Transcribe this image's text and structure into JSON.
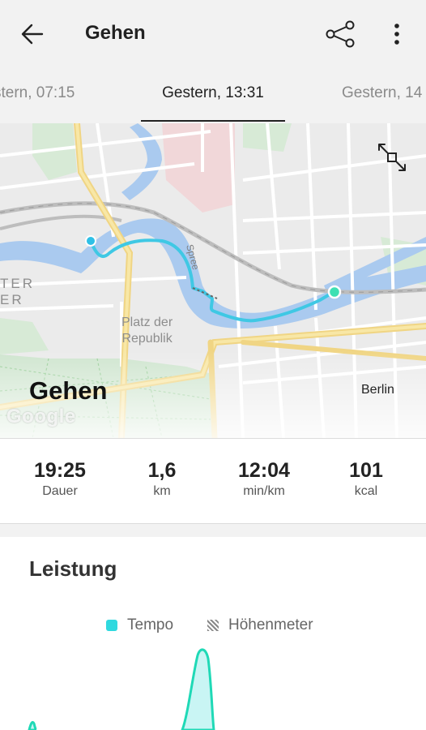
{
  "app": {
    "title": "Gehen",
    "back_icon": "arrow-left-icon",
    "share_icon": "share-icon",
    "more_icon": "more-vertical-icon"
  },
  "tabs": {
    "previous": "stern, 07:15",
    "current": "Gestern, 13:31",
    "next": "Gestern, 14"
  },
  "map": {
    "activity_title": "Gehen",
    "city": "Berlin",
    "place_label_line1": "Platz der",
    "place_label_line2": "Republik",
    "river_label": "Spree",
    "district_label_line1": "TER",
    "district_label_line2": "ER",
    "attribution": "Google",
    "expand_icon": "expand-icon",
    "route_color": "#3fc8e4"
  },
  "stats": [
    {
      "value": "19:25",
      "label": "Dauer"
    },
    {
      "value": "1,6",
      "label": "km"
    },
    {
      "value": "12:04",
      "label": "min/km"
    },
    {
      "value": "101",
      "label": "kcal"
    }
  ],
  "performance": {
    "title": "Leistung",
    "legend": [
      {
        "label": "Tempo",
        "color": "#2fd9df"
      },
      {
        "label": "Höhenmeter",
        "color": "#888888"
      }
    ]
  }
}
